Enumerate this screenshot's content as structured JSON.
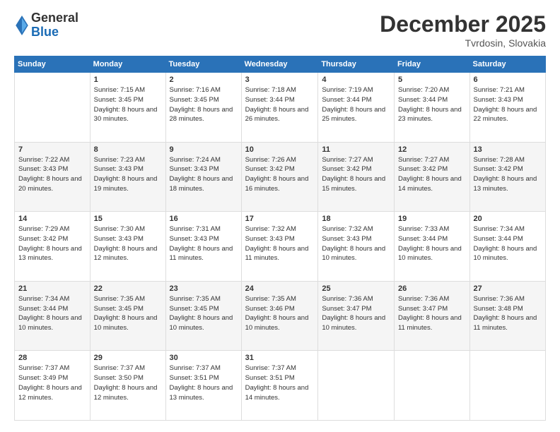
{
  "header": {
    "logo_general": "General",
    "logo_blue": "Blue",
    "month_title": "December 2025",
    "location": "Tvrdosin, Slovakia"
  },
  "calendar": {
    "days_of_week": [
      "Sunday",
      "Monday",
      "Tuesday",
      "Wednesday",
      "Thursday",
      "Friday",
      "Saturday"
    ],
    "weeks": [
      [
        {
          "num": "",
          "info": ""
        },
        {
          "num": "1",
          "info": "Sunrise: 7:15 AM\nSunset: 3:45 PM\nDaylight: 8 hours\nand 30 minutes."
        },
        {
          "num": "2",
          "info": "Sunrise: 7:16 AM\nSunset: 3:45 PM\nDaylight: 8 hours\nand 28 minutes."
        },
        {
          "num": "3",
          "info": "Sunrise: 7:18 AM\nSunset: 3:44 PM\nDaylight: 8 hours\nand 26 minutes."
        },
        {
          "num": "4",
          "info": "Sunrise: 7:19 AM\nSunset: 3:44 PM\nDaylight: 8 hours\nand 25 minutes."
        },
        {
          "num": "5",
          "info": "Sunrise: 7:20 AM\nSunset: 3:44 PM\nDaylight: 8 hours\nand 23 minutes."
        },
        {
          "num": "6",
          "info": "Sunrise: 7:21 AM\nSunset: 3:43 PM\nDaylight: 8 hours\nand 22 minutes."
        }
      ],
      [
        {
          "num": "7",
          "info": "Sunrise: 7:22 AM\nSunset: 3:43 PM\nDaylight: 8 hours\nand 20 minutes."
        },
        {
          "num": "8",
          "info": "Sunrise: 7:23 AM\nSunset: 3:43 PM\nDaylight: 8 hours\nand 19 minutes."
        },
        {
          "num": "9",
          "info": "Sunrise: 7:24 AM\nSunset: 3:43 PM\nDaylight: 8 hours\nand 18 minutes."
        },
        {
          "num": "10",
          "info": "Sunrise: 7:26 AM\nSunset: 3:42 PM\nDaylight: 8 hours\nand 16 minutes."
        },
        {
          "num": "11",
          "info": "Sunrise: 7:27 AM\nSunset: 3:42 PM\nDaylight: 8 hours\nand 15 minutes."
        },
        {
          "num": "12",
          "info": "Sunrise: 7:27 AM\nSunset: 3:42 PM\nDaylight: 8 hours\nand 14 minutes."
        },
        {
          "num": "13",
          "info": "Sunrise: 7:28 AM\nSunset: 3:42 PM\nDaylight: 8 hours\nand 13 minutes."
        }
      ],
      [
        {
          "num": "14",
          "info": "Sunrise: 7:29 AM\nSunset: 3:42 PM\nDaylight: 8 hours\nand 13 minutes."
        },
        {
          "num": "15",
          "info": "Sunrise: 7:30 AM\nSunset: 3:43 PM\nDaylight: 8 hours\nand 12 minutes."
        },
        {
          "num": "16",
          "info": "Sunrise: 7:31 AM\nSunset: 3:43 PM\nDaylight: 8 hours\nand 11 minutes."
        },
        {
          "num": "17",
          "info": "Sunrise: 7:32 AM\nSunset: 3:43 PM\nDaylight: 8 hours\nand 11 minutes."
        },
        {
          "num": "18",
          "info": "Sunrise: 7:32 AM\nSunset: 3:43 PM\nDaylight: 8 hours\nand 10 minutes."
        },
        {
          "num": "19",
          "info": "Sunrise: 7:33 AM\nSunset: 3:44 PM\nDaylight: 8 hours\nand 10 minutes."
        },
        {
          "num": "20",
          "info": "Sunrise: 7:34 AM\nSunset: 3:44 PM\nDaylight: 8 hours\nand 10 minutes."
        }
      ],
      [
        {
          "num": "21",
          "info": "Sunrise: 7:34 AM\nSunset: 3:44 PM\nDaylight: 8 hours\nand 10 minutes."
        },
        {
          "num": "22",
          "info": "Sunrise: 7:35 AM\nSunset: 3:45 PM\nDaylight: 8 hours\nand 10 minutes."
        },
        {
          "num": "23",
          "info": "Sunrise: 7:35 AM\nSunset: 3:45 PM\nDaylight: 8 hours\nand 10 minutes."
        },
        {
          "num": "24",
          "info": "Sunrise: 7:35 AM\nSunset: 3:46 PM\nDaylight: 8 hours\nand 10 minutes."
        },
        {
          "num": "25",
          "info": "Sunrise: 7:36 AM\nSunset: 3:47 PM\nDaylight: 8 hours\nand 10 minutes."
        },
        {
          "num": "26",
          "info": "Sunrise: 7:36 AM\nSunset: 3:47 PM\nDaylight: 8 hours\nand 11 minutes."
        },
        {
          "num": "27",
          "info": "Sunrise: 7:36 AM\nSunset: 3:48 PM\nDaylight: 8 hours\nand 11 minutes."
        }
      ],
      [
        {
          "num": "28",
          "info": "Sunrise: 7:37 AM\nSunset: 3:49 PM\nDaylight: 8 hours\nand 12 minutes."
        },
        {
          "num": "29",
          "info": "Sunrise: 7:37 AM\nSunset: 3:50 PM\nDaylight: 8 hours\nand 12 minutes."
        },
        {
          "num": "30",
          "info": "Sunrise: 7:37 AM\nSunset: 3:51 PM\nDaylight: 8 hours\nand 13 minutes."
        },
        {
          "num": "31",
          "info": "Sunrise: 7:37 AM\nSunset: 3:51 PM\nDaylight: 8 hours\nand 14 minutes."
        },
        {
          "num": "",
          "info": ""
        },
        {
          "num": "",
          "info": ""
        },
        {
          "num": "",
          "info": ""
        }
      ]
    ]
  }
}
